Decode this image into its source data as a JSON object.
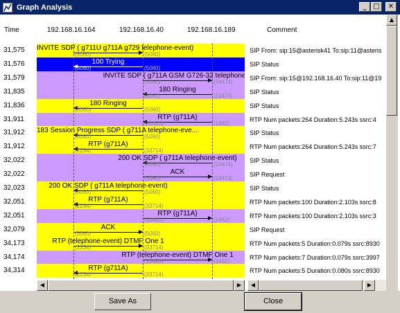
{
  "window": {
    "title": "Graph Analysis",
    "min_label": "_",
    "max_label": "□",
    "close_label": "✕"
  },
  "header": {
    "time": "Time",
    "nodes": [
      "192.168.16.164",
      "192.168.16.40",
      "192.168.16.189"
    ],
    "comment": "Comment"
  },
  "rows": [
    {
      "time": "31,575",
      "band": "yellow",
      "label": "INVITE SDP ( g711U g711A g729 telephone-event)",
      "dir": "r",
      "from": 0,
      "to": 1,
      "port_l": "(5060)",
      "port_r": "(5060)",
      "comment": "SIP From: sip:15@asterisk41 To:sip:11@asteris"
    },
    {
      "time": "31,576",
      "band": "blue",
      "label": "100 Trying",
      "dir": "l",
      "from": 0,
      "to": 1,
      "port_l": "(5060)",
      "port_r": "(5060)",
      "comment": "SIP Status"
    },
    {
      "time": "31,579",
      "band": "purple",
      "label": "INVITE SDP ( g711A GSM G726-32 telephone-e",
      "dir": "r",
      "from": 1,
      "to": 2,
      "port_l": "(5060)",
      "port_r": "(24474)",
      "comment": "SIP From: sip:15@192.168.16.40 To:sip:11@19"
    },
    {
      "time": "31,835",
      "band": "purple",
      "label": "180 Ringing",
      "dir": "l",
      "from": 1,
      "to": 2,
      "port_l": "(5060)",
      "port_r": "(24474)",
      "comment": "SIP Status"
    },
    {
      "time": "31,836",
      "band": "yellow",
      "label": "180 Ringing",
      "dir": "l",
      "from": 0,
      "to": 1,
      "port_l": "(5060)",
      "port_r": "(5060)",
      "comment": "SIP Status"
    },
    {
      "time": "31,911",
      "band": "purple",
      "label": "RTP (g711A)",
      "dir": "l",
      "from": 1,
      "to": 2,
      "port_l": "(30480)",
      "port_r": "(1462)",
      "comment": "RTP Num packets:264  Duration:5.243s ssrc:4"
    },
    {
      "time": "31,912",
      "band": "yellow",
      "label": "183 Session Progress SDP ( g711A telephone-eve...",
      "dir": "l",
      "from": 0,
      "to": 1,
      "port_l": "(5060)",
      "port_r": "(5060)",
      "comment": "SIP Status"
    },
    {
      "time": "31,912",
      "band": "yellow",
      "label": "RTP (g711A)",
      "dir": "l",
      "from": 0,
      "to": 1,
      "port_l": "(2234)",
      "port_r": "(33714)",
      "comment": "RTP Num packets:264  Duration:5.243s ssrc:7"
    },
    {
      "time": "32,022",
      "band": "purple",
      "label": "200 OK SDP ( g711A telephone-event)",
      "dir": "l",
      "from": 1,
      "to": 2,
      "port_l": "(5060)",
      "port_r": "(24474)",
      "comment": "SIP Status"
    },
    {
      "time": "32,022",
      "band": "purple",
      "label": "ACK",
      "dir": "r",
      "from": 1,
      "to": 2,
      "port_l": "(5060)",
      "port_r": "(24474)",
      "comment": "SIP Request"
    },
    {
      "time": "32,023",
      "band": "yellow",
      "label": "200 OK SDP ( g711A telephone-event)",
      "dir": "l",
      "from": 0,
      "to": 1,
      "port_l": "(5060)",
      "port_r": "(5060)",
      "comment": "SIP Status"
    },
    {
      "time": "32,051",
      "band": "yellow",
      "label": "RTP (g711A)",
      "dir": "l",
      "from": 0,
      "to": 1,
      "port_l": "(2234)",
      "port_r": "(33714)",
      "comment": "RTP Num packets:100  Duration:2.103s ssrc:8"
    },
    {
      "time": "32,051",
      "band": "purple",
      "label": "RTP (g711A)",
      "dir": "r",
      "from": 1,
      "to": 2,
      "port_l": "(30480)",
      "port_r": "(1462)",
      "comment": "RTP Num packets:100  Duration:2.103s ssrc:3"
    },
    {
      "time": "32,079",
      "band": "yellow",
      "label": "ACK",
      "dir": "r",
      "from": 0,
      "to": 1,
      "port_l": "(5060)",
      "port_r": "(5060)",
      "comment": "SIP Request"
    },
    {
      "time": "34,173",
      "band": "yellow",
      "label": "RTP (telephone-event) DTMF One 1",
      "dir": "r",
      "from": 0,
      "to": 1,
      "port_l": "(2234)",
      "port_r": "(33714)",
      "comment": "RTP Num packets:5   Duration:0.079s ssrc:8930"
    },
    {
      "time": "34,174",
      "band": "purple",
      "label": "RTP (telephone-event) DTMF One 1",
      "dir": "r",
      "from": 1,
      "to": 2,
      "port_l": "(30480)",
      "port_r": "(1462)",
      "comment": "RTP Num packets:7   Duration:0.079s ssrc:3997"
    },
    {
      "time": "34,314",
      "band": "yellow",
      "label": "RTP (g711A)",
      "dir": "l",
      "from": 0,
      "to": 1,
      "port_l": "(2234)",
      "port_r": "(33714)",
      "comment": "RTP Num packets:5   Duration:0.080s ssrc:8930"
    }
  ],
  "colors": {
    "yellow": "#ffff00",
    "purple": "#cc99ff",
    "blue": "#0000ff"
  },
  "buttons": {
    "save_as": "Save As",
    "close": "Close"
  }
}
